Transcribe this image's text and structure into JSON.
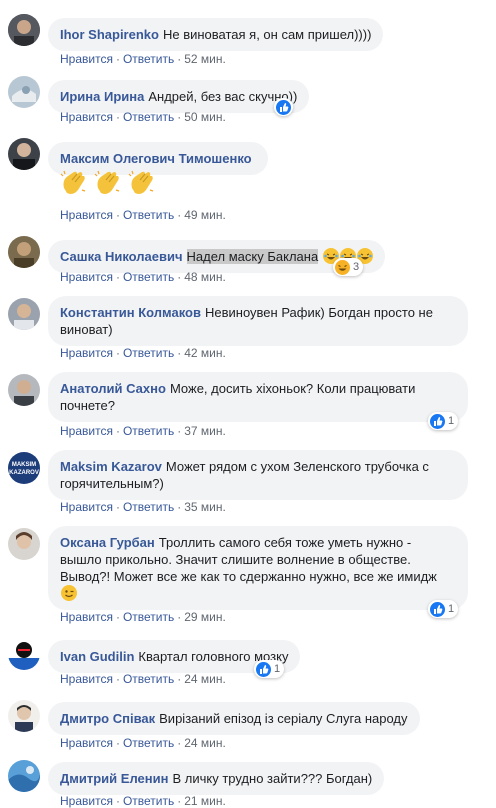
{
  "comments": [
    {
      "author": "Ihor Shapirenko",
      "text": "Не виноватая я, он сам пришел))))",
      "like": "Нравится",
      "reply": "Ответить",
      "time": "52 мин."
    },
    {
      "author": "Ирина Ирина",
      "text": "Андрей, без вас скучно))",
      "like": "Нравится",
      "reply": "Ответить",
      "time": "50 мин.",
      "reaction_count": ""
    },
    {
      "author": "Максим Олегович Тимошенко",
      "text": "",
      "like": "Нравится",
      "reply": "Ответить",
      "time": "49 мин."
    },
    {
      "author": "Сашка Николаевич",
      "text": "Надел маску Баклана",
      "like": "Нравится",
      "reply": "Ответить",
      "time": "48 мин.",
      "reaction_count": "3"
    },
    {
      "author": "Константин Колмаков",
      "text": "Невиноувен Рафик) Богдан просто не виноват)",
      "like": "Нравится",
      "reply": "Ответить",
      "time": "42 мин."
    },
    {
      "author": "Анатолий Сахно",
      "text": "Може, досить хіхоньок? Коли працювати почнете?",
      "like": "Нравится",
      "reply": "Ответить",
      "time": "37 мин.",
      "reaction_count": "1"
    },
    {
      "author": "Maksim Kazarov",
      "text": "Может рядом с ухом Зеленского трубочка с горячительным?)",
      "like": "Нравится",
      "reply": "Ответить",
      "time": "35 мин.",
      "avatar_text": [
        "MAKSIM",
        "KAZAROV"
      ]
    },
    {
      "author": "Оксана Гурбан",
      "text": "Троллить самого себя тоже уметь нужно - вышло прикольно. Значит слишите волнение в обществе. Вывод?! Может все же как то сдержанно нужно, все же имидж",
      "like": "Нравится",
      "reply": "Ответить",
      "time": "29 мин.",
      "reaction_count": "1"
    },
    {
      "author": "Ivan Gudilin",
      "text": "Квартал головного мозку",
      "like": "Нравится",
      "reply": "Ответить",
      "time": "24 мин.",
      "reaction_count": "1"
    },
    {
      "author": "Дмитро Співак",
      "text": "Вирізаний епізод із серіалу Слуга народу",
      "like": "Нравится",
      "reply": "Ответить",
      "time": "24 мин."
    },
    {
      "author": "Дмитрий Еленин",
      "text": "В личку трудно зайти??? Богдан)",
      "like": "Нравится",
      "reply": "Ответить",
      "time": "21 мин."
    }
  ],
  "icons": {
    "like": "like-reaction-icon",
    "haha": "haha-reaction-icon",
    "clap": "clapping-hands-emoji"
  },
  "colors": {
    "author": "#385898",
    "bubble": "#f2f3f5",
    "like": "#1877f2",
    "haha": "#f7b125"
  }
}
